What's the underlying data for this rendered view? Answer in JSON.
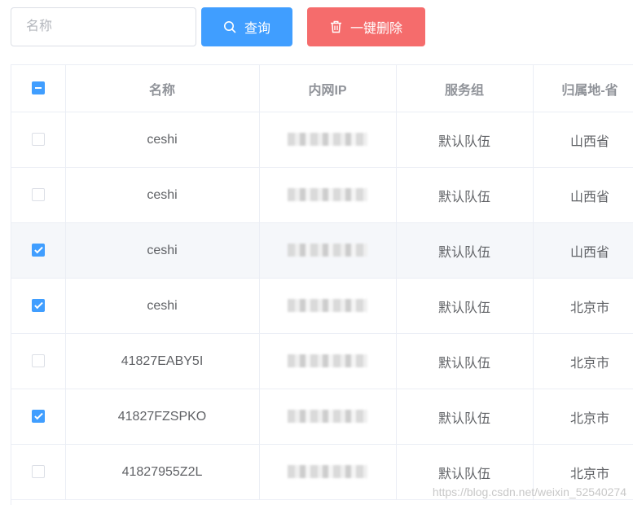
{
  "toolbar": {
    "search_placeholder": "名称",
    "query_label": "查询",
    "delete_all_label": "一键删除"
  },
  "table": {
    "columns": [
      "名称",
      "内网IP",
      "服务组",
      "归属地-省"
    ],
    "select_all": "indeterminate",
    "rows": [
      {
        "selected": false,
        "name": "ceshi",
        "group": "默认队伍",
        "province": "山西省"
      },
      {
        "selected": false,
        "name": "ceshi",
        "group": "默认队伍",
        "province": "山西省"
      },
      {
        "selected": true,
        "name": "ceshi",
        "group": "默认队伍",
        "province": "山西省"
      },
      {
        "selected": true,
        "name": "ceshi",
        "group": "默认队伍",
        "province": "北京市"
      },
      {
        "selected": false,
        "name": "41827EABY5I",
        "group": "默认队伍",
        "province": "北京市"
      },
      {
        "selected": true,
        "name": "41827FZSPKO",
        "group": "默认队伍",
        "province": "北京市"
      },
      {
        "selected": false,
        "name": "41827955Z2L",
        "group": "默认队伍",
        "province": "北京市"
      }
    ]
  },
  "colors": {
    "primary": "#409eff",
    "danger": "#f56c6c",
    "border": "#ebeef5",
    "header_text": "#909399",
    "cell_text": "#606266",
    "hover_row": "#f5f7fa"
  },
  "icons": {
    "query": "search-icon",
    "delete": "trash-icon"
  },
  "watermark": "https://blog.csdn.net/weixin_52540274"
}
